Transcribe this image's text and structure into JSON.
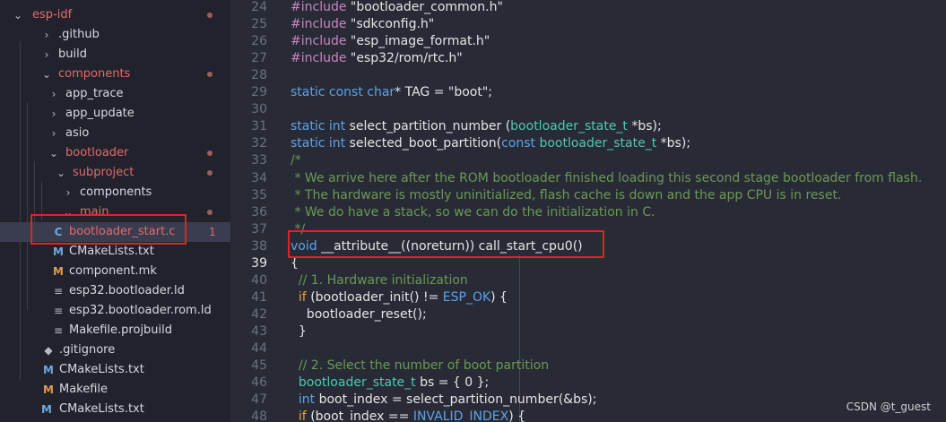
{
  "explorer": {
    "items": [
      {
        "label": "esp-idf",
        "depth": 0,
        "expanded": true,
        "icon": "",
        "modified": true,
        "dot": true
      },
      {
        "label": ".github",
        "depth": 1,
        "expanded": false,
        "icon": "",
        "modified": false
      },
      {
        "label": "build",
        "depth": 1,
        "expanded": false,
        "icon": "",
        "modified": false
      },
      {
        "label": "components",
        "depth": 1,
        "expanded": true,
        "icon": "",
        "modified": true,
        "dot": true
      },
      {
        "label": "app_trace",
        "depth": 2,
        "expanded": false,
        "icon": "",
        "modified": false
      },
      {
        "label": "app_update",
        "depth": 2,
        "expanded": false,
        "icon": "",
        "modified": false
      },
      {
        "label": "asio",
        "depth": 2,
        "expanded": false,
        "icon": "",
        "modified": false
      },
      {
        "label": "bootloader",
        "depth": 2,
        "expanded": true,
        "icon": "",
        "modified": true,
        "dot": true
      },
      {
        "label": "subproject",
        "depth": 3,
        "expanded": true,
        "icon": "",
        "modified": true,
        "dot": true
      },
      {
        "label": "components",
        "depth": 4,
        "expanded": false,
        "icon": "",
        "modified": false
      },
      {
        "label": "main",
        "depth": 4,
        "expanded": true,
        "icon": "",
        "modified": true,
        "dot": true
      },
      {
        "label": "bootloader_start.c",
        "depth": 5,
        "icon": "C",
        "iconClass": "icon-c",
        "modified": true,
        "selected": true,
        "badge": "1"
      },
      {
        "label": "CMakeLists.txt",
        "depth": 5,
        "icon": "M",
        "iconClass": "icon-m",
        "modified": false
      },
      {
        "label": "component.mk",
        "depth": 5,
        "icon": "M",
        "iconClass": "icon-mk",
        "modified": false
      },
      {
        "label": "esp32.bootloader.ld",
        "depth": 5,
        "icon": "≡",
        "iconClass": "icon-ld",
        "modified": false
      },
      {
        "label": "esp32.bootloader.rom.ld",
        "depth": 5,
        "icon": "≡",
        "iconClass": "icon-ld",
        "modified": false
      },
      {
        "label": "Makefile.projbuild",
        "depth": 5,
        "icon": "≡",
        "iconClass": "icon-ld",
        "modified": false
      },
      {
        "label": ".gitignore",
        "depth": 4,
        "icon": "◆",
        "iconClass": "icon-git",
        "modified": false
      },
      {
        "label": "CMakeLists.txt",
        "depth": 4,
        "icon": "M",
        "iconClass": "icon-m",
        "modified": false
      },
      {
        "label": "Makefile",
        "depth": 4,
        "icon": "M",
        "iconClass": "icon-mk",
        "modified": false
      },
      {
        "label": "CMakeLists.txt",
        "depth": 3,
        "icon": "M",
        "iconClass": "icon-m",
        "modified": false
      }
    ]
  },
  "editor": {
    "lines": [
      {
        "n": "24",
        "t": [
          [
            "pp",
            "#include "
          ],
          [
            "str",
            "\"bootloader_common.h\""
          ]
        ]
      },
      {
        "n": "25",
        "t": [
          [
            "pp",
            "#include "
          ],
          [
            "str",
            "\"sdkconfig.h\""
          ]
        ]
      },
      {
        "n": "26",
        "t": [
          [
            "pp",
            "#include "
          ],
          [
            "str",
            "\"esp_image_format.h\""
          ]
        ]
      },
      {
        "n": "27",
        "t": [
          [
            "pp",
            "#include "
          ],
          [
            "str",
            "\"esp32/rom/rtc.h\""
          ]
        ]
      },
      {
        "n": "28",
        "t": []
      },
      {
        "n": "29",
        "t": [
          [
            "kw",
            "static const char"
          ],
          [
            "plain",
            "* TAG = "
          ],
          [
            "str",
            "\"boot\""
          ],
          [
            "plain",
            ";"
          ]
        ]
      },
      {
        "n": "30",
        "t": []
      },
      {
        "n": "31",
        "t": [
          [
            "kw",
            "static int "
          ],
          [
            "fn",
            "select_partition_number "
          ],
          [
            "plain",
            "("
          ],
          [
            "type",
            "bootloader_state_t "
          ],
          [
            "plain",
            "*bs);"
          ]
        ]
      },
      {
        "n": "32",
        "t": [
          [
            "kw",
            "static int "
          ],
          [
            "fn",
            "selected_boot_partition"
          ],
          [
            "plain",
            "("
          ],
          [
            "kw",
            "const "
          ],
          [
            "type",
            "bootloader_state_t "
          ],
          [
            "plain",
            "*bs);"
          ]
        ]
      },
      {
        "n": "33",
        "t": [
          [
            "cmt",
            "/*"
          ]
        ]
      },
      {
        "n": "34",
        "t": [
          [
            "cmt",
            " * We arrive here after the ROM bootloader finished loading this second stage bootloader from flash."
          ]
        ]
      },
      {
        "n": "35",
        "t": [
          [
            "cmt",
            " * The hardware is mostly uninitialized, flash cache is down and the app CPU is in reset."
          ]
        ]
      },
      {
        "n": "36",
        "t": [
          [
            "cmt",
            " * We do have a stack, so we can do the initialization in C."
          ]
        ]
      },
      {
        "n": "37",
        "t": [
          [
            "cmt",
            " */"
          ]
        ]
      },
      {
        "n": "38",
        "t": [
          [
            "kw",
            "void "
          ],
          [
            "plain",
            "__attribute__((noreturn)) call_start_cpu0()"
          ]
        ]
      },
      {
        "n": "39",
        "t": [
          [
            "plain",
            "{"
          ]
        ],
        "current": true
      },
      {
        "n": "40",
        "t": [
          [
            "plain",
            "  "
          ],
          [
            "cmt",
            "// 1. Hardware initialization"
          ]
        ]
      },
      {
        "n": "41",
        "t": [
          [
            "plain",
            "  "
          ],
          [
            "ctrl",
            "if "
          ],
          [
            "plain",
            "(bootloader_init() != "
          ],
          [
            "const",
            "ESP_OK"
          ],
          [
            "plain",
            ") {"
          ]
        ]
      },
      {
        "n": "42",
        "t": [
          [
            "plain",
            "    bootloader_reset();"
          ]
        ]
      },
      {
        "n": "43",
        "t": [
          [
            "plain",
            "  }"
          ]
        ]
      },
      {
        "n": "44",
        "t": []
      },
      {
        "n": "45",
        "t": [
          [
            "plain",
            "  "
          ],
          [
            "cmt",
            "// 2. Select the number of boot partition"
          ]
        ]
      },
      {
        "n": "46",
        "t": [
          [
            "plain",
            "  "
          ],
          [
            "type",
            "bootloader_state_t "
          ],
          [
            "plain",
            "bs = { 0 };"
          ]
        ]
      },
      {
        "n": "47",
        "t": [
          [
            "plain",
            "  "
          ],
          [
            "kw",
            "int "
          ],
          [
            "plain",
            "boot_index = select_partition_number(&bs);"
          ]
        ]
      },
      {
        "n": "48",
        "t": [
          [
            "plain",
            "  "
          ],
          [
            "ctrl",
            "if "
          ],
          [
            "plain",
            "(boot_index == "
          ],
          [
            "const",
            "INVALID_INDEX"
          ],
          [
            "plain",
            ") {"
          ]
        ]
      }
    ]
  },
  "watermark": "CSDN @t_guest",
  "colors": {
    "highlight": "#e02424",
    "modified": "#e36b6b",
    "keyword": "#5da3e8",
    "comment": "#6a9955",
    "type": "#4ec9b0"
  }
}
